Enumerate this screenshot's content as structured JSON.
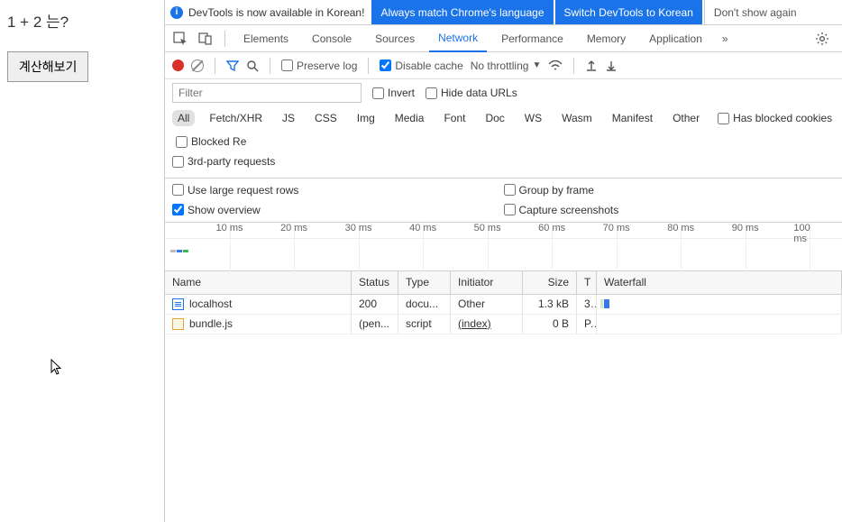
{
  "page": {
    "question": "1 + 2 는?",
    "calc_button": "계산해보기"
  },
  "banner": {
    "message": "DevTools is now available in Korean!",
    "btn_always": "Always match Chrome's language",
    "btn_switch": "Switch DevTools to Korean",
    "btn_dont": "Don't show again"
  },
  "tabs": {
    "elements": "Elements",
    "console": "Console",
    "sources": "Sources",
    "network": "Network",
    "performance": "Performance",
    "memory": "Memory",
    "application": "Application"
  },
  "toolbar": {
    "preserve_log": "Preserve log",
    "disable_cache": "Disable cache",
    "no_throttling": "No throttling"
  },
  "filter": {
    "placeholder": "Filter",
    "invert": "Invert",
    "hide_data_urls": "Hide data URLs"
  },
  "types": {
    "all": "All",
    "fetch": "Fetch/XHR",
    "js": "JS",
    "css": "CSS",
    "img": "Img",
    "media": "Media",
    "font": "Font",
    "doc": "Doc",
    "ws": "WS",
    "wasm": "Wasm",
    "manifest": "Manifest",
    "other": "Other",
    "blocked_cookies": "Has blocked cookies",
    "blocked_req": "Blocked Re"
  },
  "third_party": "3rd-party requests",
  "options": {
    "large_rows": "Use large request rows",
    "show_overview": "Show overview",
    "group_frame": "Group by frame",
    "capture_ss": "Capture screenshots"
  },
  "timeline": {
    "ticks": [
      "10 ms",
      "20 ms",
      "30 ms",
      "40 ms",
      "50 ms",
      "60 ms",
      "70 ms",
      "80 ms",
      "90 ms",
      "100 ms"
    ]
  },
  "headers": {
    "name": "Name",
    "status": "Status",
    "type": "Type",
    "initiator": "Initiator",
    "size": "Size",
    "time": "T",
    "waterfall": "Waterfall"
  },
  "rows": [
    {
      "name": "localhost",
      "status": "200",
      "type": "docu...",
      "initiator": "Other",
      "size": "1.3 kB",
      "time": "3..",
      "icon": "doc"
    },
    {
      "name": "bundle.js",
      "status": "(pen...",
      "type": "script",
      "initiator": "(index)",
      "size": "0 B",
      "time": "P..",
      "icon": "js",
      "init_link": true
    }
  ]
}
